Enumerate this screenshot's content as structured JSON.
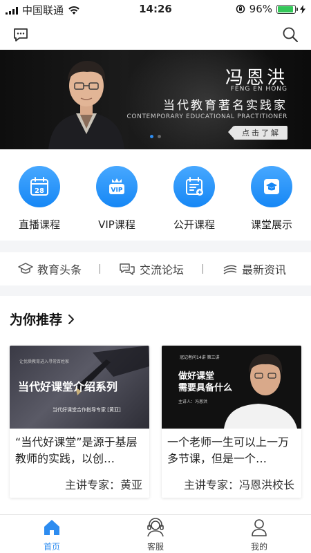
{
  "status_bar": {
    "carrier": "中国联通",
    "time": "14:26",
    "battery": "96%",
    "battery_level": 0.96
  },
  "topbar": {
    "message_icon": "message-icon",
    "search_icon": "search-icon"
  },
  "banner": {
    "name_cn": "冯恩洪",
    "name_en": "FENG EN HONG",
    "title_cn": "当代教育著名实践家",
    "title_en": "CONTEMPORARY EDUCATIONAL PRACTITIONER",
    "button": "点击了解",
    "dots": 2,
    "active_dot": 0
  },
  "categories": [
    {
      "label": "直播课程",
      "icon": "calendar-28-icon",
      "icon_text": "28"
    },
    {
      "label": "VIP课程",
      "icon": "vip-crown-icon",
      "icon_text": "VIP"
    },
    {
      "label": "公开课程",
      "icon": "calendar-plus-icon"
    },
    {
      "label": "课堂展示",
      "icon": "graduation-cap-icon"
    }
  ],
  "quick_links": [
    {
      "label": "教育头条",
      "icon": "graduation-cap-outline-icon"
    },
    {
      "label": "交流论坛",
      "icon": "chat-bubbles-icon"
    },
    {
      "label": "最新资讯",
      "icon": "news-icon"
    }
  ],
  "recommend": {
    "title": "为你推荐",
    "cards": [
      {
        "thumb_small": "让优质教育进入寻常百姓家",
        "thumb_title": "当代好课堂介绍系列",
        "thumb_sub": "当代好课堂合作指导专家 [黄亚]",
        "desc": "“当代好课堂”是源于基层教师的实践，以创…",
        "expert": "主讲专家：黄亚"
      },
      {
        "thumb_small": "冠记者问14讲 第三讲",
        "thumb_title": "做好课堂\n需要具备什么",
        "thumb_sub": "主讲人：冯恩洪",
        "desc": "一个老师一生可以上一万多节课，但是一个…",
        "expert": "主讲专家：冯恩洪校长"
      }
    ]
  },
  "tabbar": {
    "active_color": "#2d8cf0",
    "tabs": [
      {
        "label": "首页",
        "icon": "home-icon",
        "active": true
      },
      {
        "label": "客服",
        "icon": "customer-service-icon",
        "active": false
      },
      {
        "label": "我的",
        "icon": "user-icon",
        "active": false
      }
    ]
  }
}
